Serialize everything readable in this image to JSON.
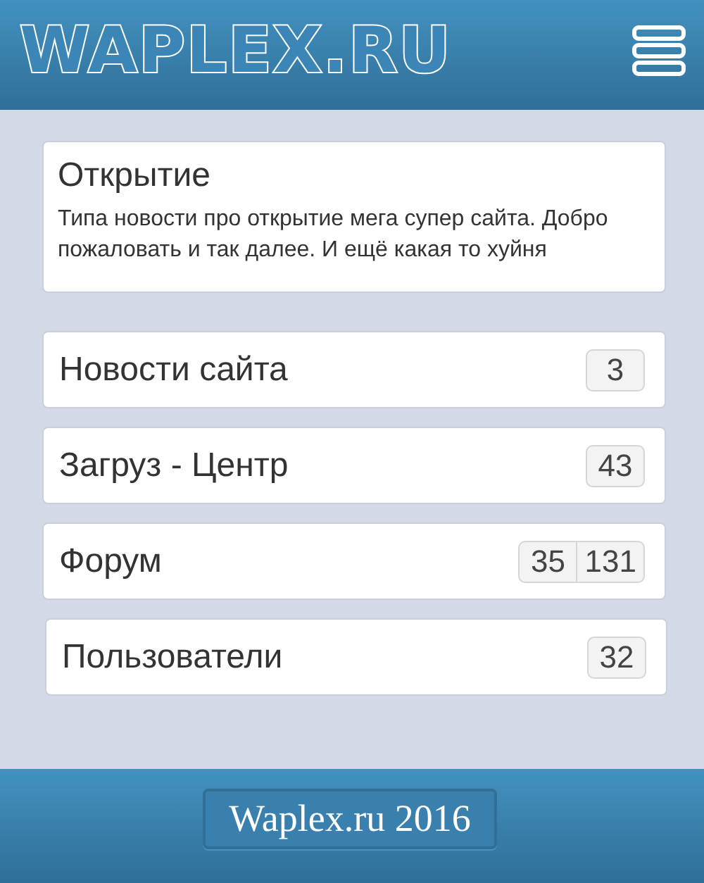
{
  "header": {
    "logo": "WAPLEX.RU"
  },
  "news": {
    "title": "Открытие",
    "text": "Типа новости про открытие мега супер сайта. Добро пожаловать и так далее. И ещё какая то хуйня"
  },
  "menu": [
    {
      "label": "Новости сайта",
      "counts": [
        "3"
      ]
    },
    {
      "label": "Загруз - Центр",
      "counts": [
        "43"
      ]
    },
    {
      "label": "Форум",
      "counts": [
        "35",
        "131"
      ]
    },
    {
      "label": "Пользователи",
      "counts": [
        "32"
      ]
    }
  ],
  "footer": {
    "label": "Waplex.ru 2016"
  }
}
